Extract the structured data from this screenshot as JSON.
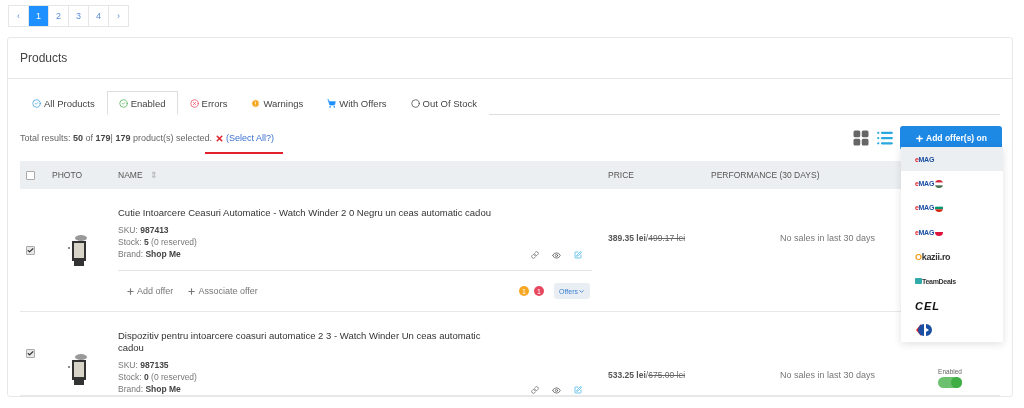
{
  "pagination": [
    {
      "label": "‹",
      "selected": false
    },
    {
      "label": "1",
      "selected": true
    },
    {
      "label": "2",
      "selected": false
    },
    {
      "label": "3",
      "selected": false
    },
    {
      "label": "4",
      "selected": false
    },
    {
      "label": "›",
      "selected": false
    }
  ],
  "panel": {
    "title": "Products",
    "tabs": [
      {
        "label": "All Products",
        "kind": "all",
        "selected": false
      },
      {
        "label": "Enabled",
        "kind": "enabled",
        "selected": true
      },
      {
        "label": "Errors",
        "kind": "errors",
        "selected": false
      },
      {
        "label": "Warnings",
        "kind": "warnings",
        "selected": false
      },
      {
        "label": "With Offers",
        "kind": "offers",
        "selected": false
      },
      {
        "label": "Out Of Stock",
        "kind": "outofstock",
        "selected": false
      }
    ],
    "summary": "Total results: **50** of **179**| **179** product(s) selected.",
    "select_all": "(Select All?)",
    "views": [
      {
        "kind": "grid",
        "selected": false
      },
      {
        "kind": "list",
        "selected": true
      }
    ],
    "add_offers_button": "Add offer(s) on",
    "marketplaces": [
      {
        "kind": "emag",
        "label": "eMAG",
        "selected": true
      },
      {
        "kind": "emaghu",
        "label": "eMAG",
        "selected": false
      },
      {
        "kind": "emagbg",
        "label": "eMAG",
        "selected": false
      },
      {
        "kind": "emagpl",
        "label": "eMAG",
        "selected": false
      },
      {
        "kind": "okazii",
        "label": "Okazii.ro",
        "selected": false
      },
      {
        "kind": "teamdeals",
        "label": "TeamDeals",
        "selected": false
      },
      {
        "kind": "cel",
        "label": "CEL",
        "selected": false
      },
      {
        "kind": "carrefour",
        "selected": false
      }
    ],
    "table": {
      "header_checked": false,
      "columns": [
        "PHOTO",
        "NAME",
        "PRICE",
        "PERFORMANCE (30 DAYS)"
      ],
      "name_sort": "⇕",
      "rows": [
        {
          "checked": true,
          "name": "Cutie Intoarcere Ceasuri Automatice - Watch Winder 2 0 Negru un ceas automatic cadou",
          "sku_label": "SKU:",
          "sku": "987413",
          "stock_label": "Stock:",
          "stock": "5",
          "reserved": "(0 reserved)",
          "brand_label": "Brand:",
          "brand": "Shop Me",
          "price": "389.35 lei",
          "separator": "/",
          "old_price": "499.17 lei",
          "performance": "No sales in last 30 days",
          "add_offer": "Add offer",
          "associate_offer": "Associate offer",
          "badges": [
            {
              "text": "1",
              "color": "#f5a623"
            },
            {
              "text": "1",
              "color": "#e8485f"
            }
          ],
          "offers_button": "Offers"
        },
        {
          "checked": true,
          "name": "Dispozitiv pentru intoarcere coasuri automatice 2 3 - Watch Winder Un ceas automatic cadou",
          "sku_label": "SKU:",
          "sku": "987135",
          "stock_label": "Stock:",
          "stock": "0",
          "reserved": "(0 reserved)",
          "brand_label": "Brand:",
          "brand": "Shop Me",
          "price": "533.25 lei",
          "separator": "/",
          "old_price": "675.00 lei",
          "performance": "No sales in last 30 days",
          "status": {
            "label": "Enabled",
            "on": true
          }
        }
      ]
    }
  }
}
